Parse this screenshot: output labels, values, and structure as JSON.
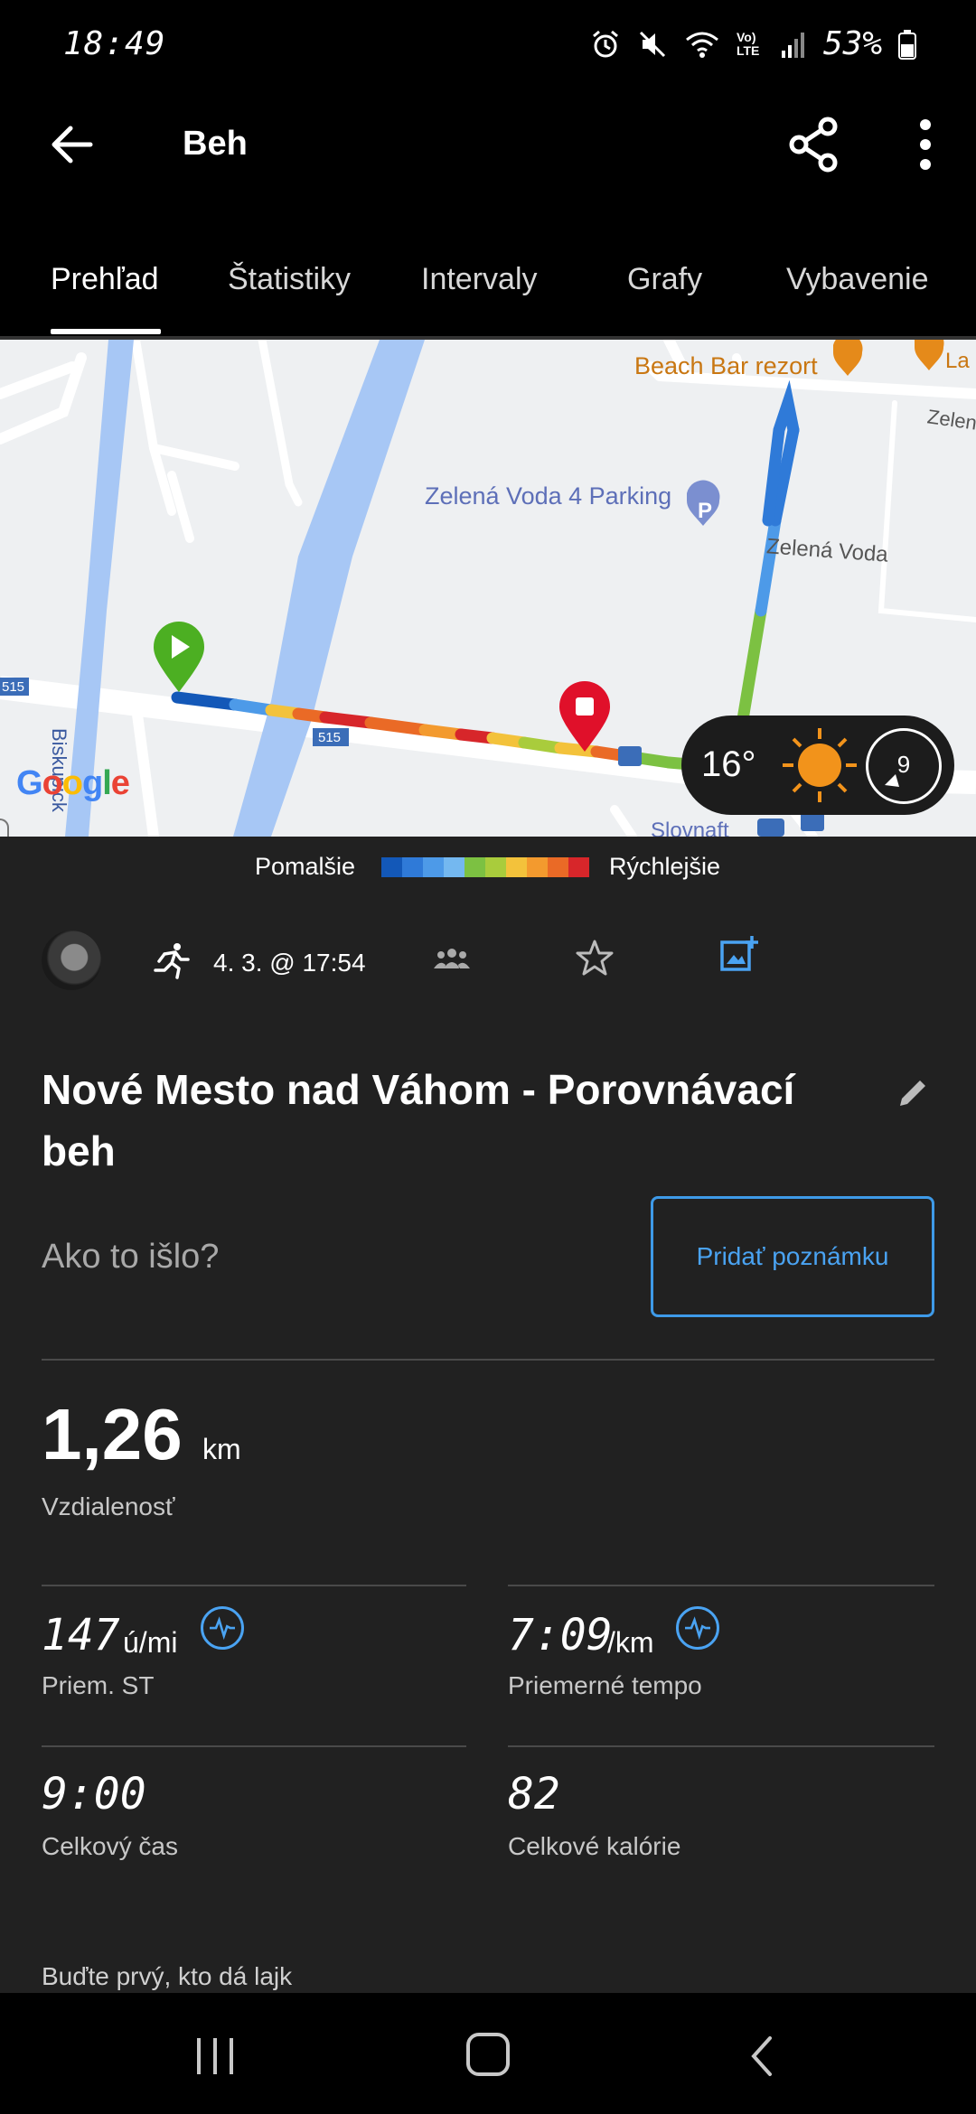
{
  "status_bar": {
    "time": "18:49",
    "network": "Vo) LTE",
    "battery": "53%"
  },
  "app_bar": {
    "title": "Beh"
  },
  "tabs": [
    {
      "label": "Prehľad",
      "active": true
    },
    {
      "label": "Štatistiky",
      "active": false
    },
    {
      "label": "Intervaly",
      "active": false
    },
    {
      "label": "Grafy",
      "active": false
    },
    {
      "label": "Vybavenie",
      "active": false
    }
  ],
  "map": {
    "labels": {
      "beach_bar": "Beach Bar rezort",
      "la": "La",
      "zelen": "Zelen",
      "parking": "Zelená Voda 4 Parking",
      "zelena_voda": "Zelená Voda",
      "road_515_left": "515",
      "road_515": "515",
      "biskup": "Biskupick",
      "slovnaft": "Slovnaft",
      "google": "Google"
    },
    "weather": {
      "temperature": "16°",
      "wind": "9"
    },
    "colors": {
      "water": "#a7c7f5",
      "start": "#4caf22",
      "end": "#e0102a"
    }
  },
  "legend": {
    "slow_label": "Pomalšie",
    "fast_label": "Rýchlejšie",
    "colors": [
      "#1358b8",
      "#2f7ad8",
      "#4d9ae8",
      "#74b8f0",
      "#7cc142",
      "#a9cc3c",
      "#f3c23b",
      "#f39a2e",
      "#ea6a26",
      "#d7262a"
    ]
  },
  "activity": {
    "date": "4. 3. @ 17:54",
    "title": "Nové Mesto nad Váhom - Porovnávací beh",
    "note_prompt": "Ako to išlo?",
    "note_button": "Pridať poznámku"
  },
  "stats": {
    "distance": {
      "value": "1,26",
      "unit": "km",
      "label": "Vzdialenosť"
    },
    "heart_rate": {
      "value": "147",
      "unit": "ú/mi",
      "label": "Priem. ST"
    },
    "pace": {
      "value": "7:09",
      "unit": "/km",
      "label": "Priemerné tempo"
    },
    "time": {
      "value": "9:00",
      "label": "Celkový čas"
    },
    "calories": {
      "value": "82",
      "label": "Celkové kalórie"
    }
  },
  "social": {
    "like_prompt": "Buďte prvý, kto dá lajk"
  }
}
